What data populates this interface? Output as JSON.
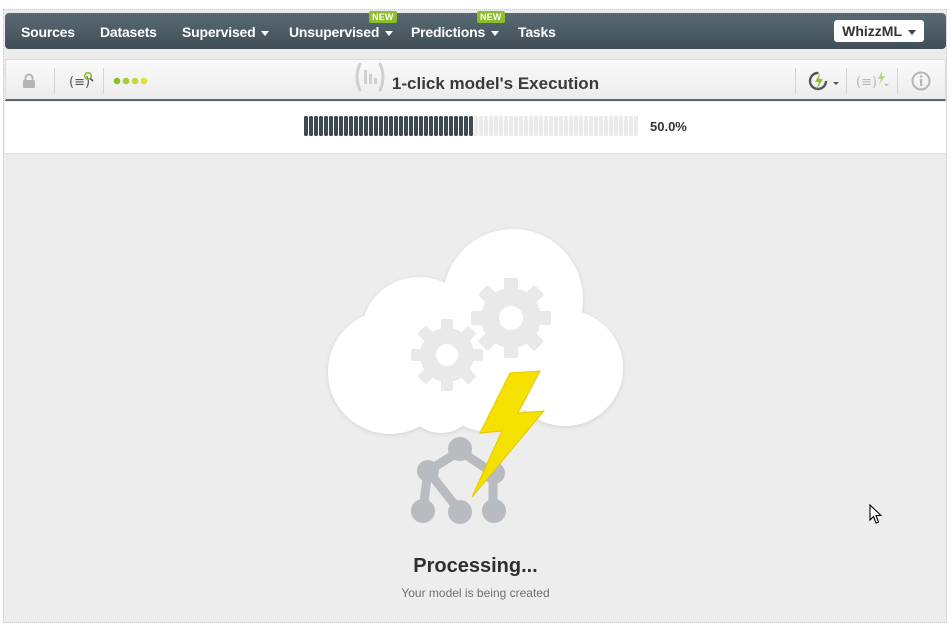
{
  "nav": {
    "items": [
      {
        "label": "Sources"
      },
      {
        "label": "Datasets"
      },
      {
        "label": "Supervised"
      },
      {
        "label": "Unsupervised",
        "badge": "NEW"
      },
      {
        "label": "Predictions",
        "badge": "NEW"
      },
      {
        "label": "Tasks"
      }
    ],
    "account_menu": "WhizzML",
    "badge_color": "#8bbf2a"
  },
  "toolbar": {
    "title": "1-click model's Execution",
    "icons_left": [
      "lock-icon",
      "script-search-icon",
      "status-dots-icon"
    ],
    "icons_right": [
      "reload-execution-icon",
      "script-execute-icon",
      "info-icon"
    ]
  },
  "progress": {
    "percent_label": "50.0%",
    "fraction": 0.5,
    "fill_color": "#3d4a52",
    "empty_color": "#eaeaea"
  },
  "status": {
    "heading": "Processing...",
    "message": "Your model is being created"
  }
}
